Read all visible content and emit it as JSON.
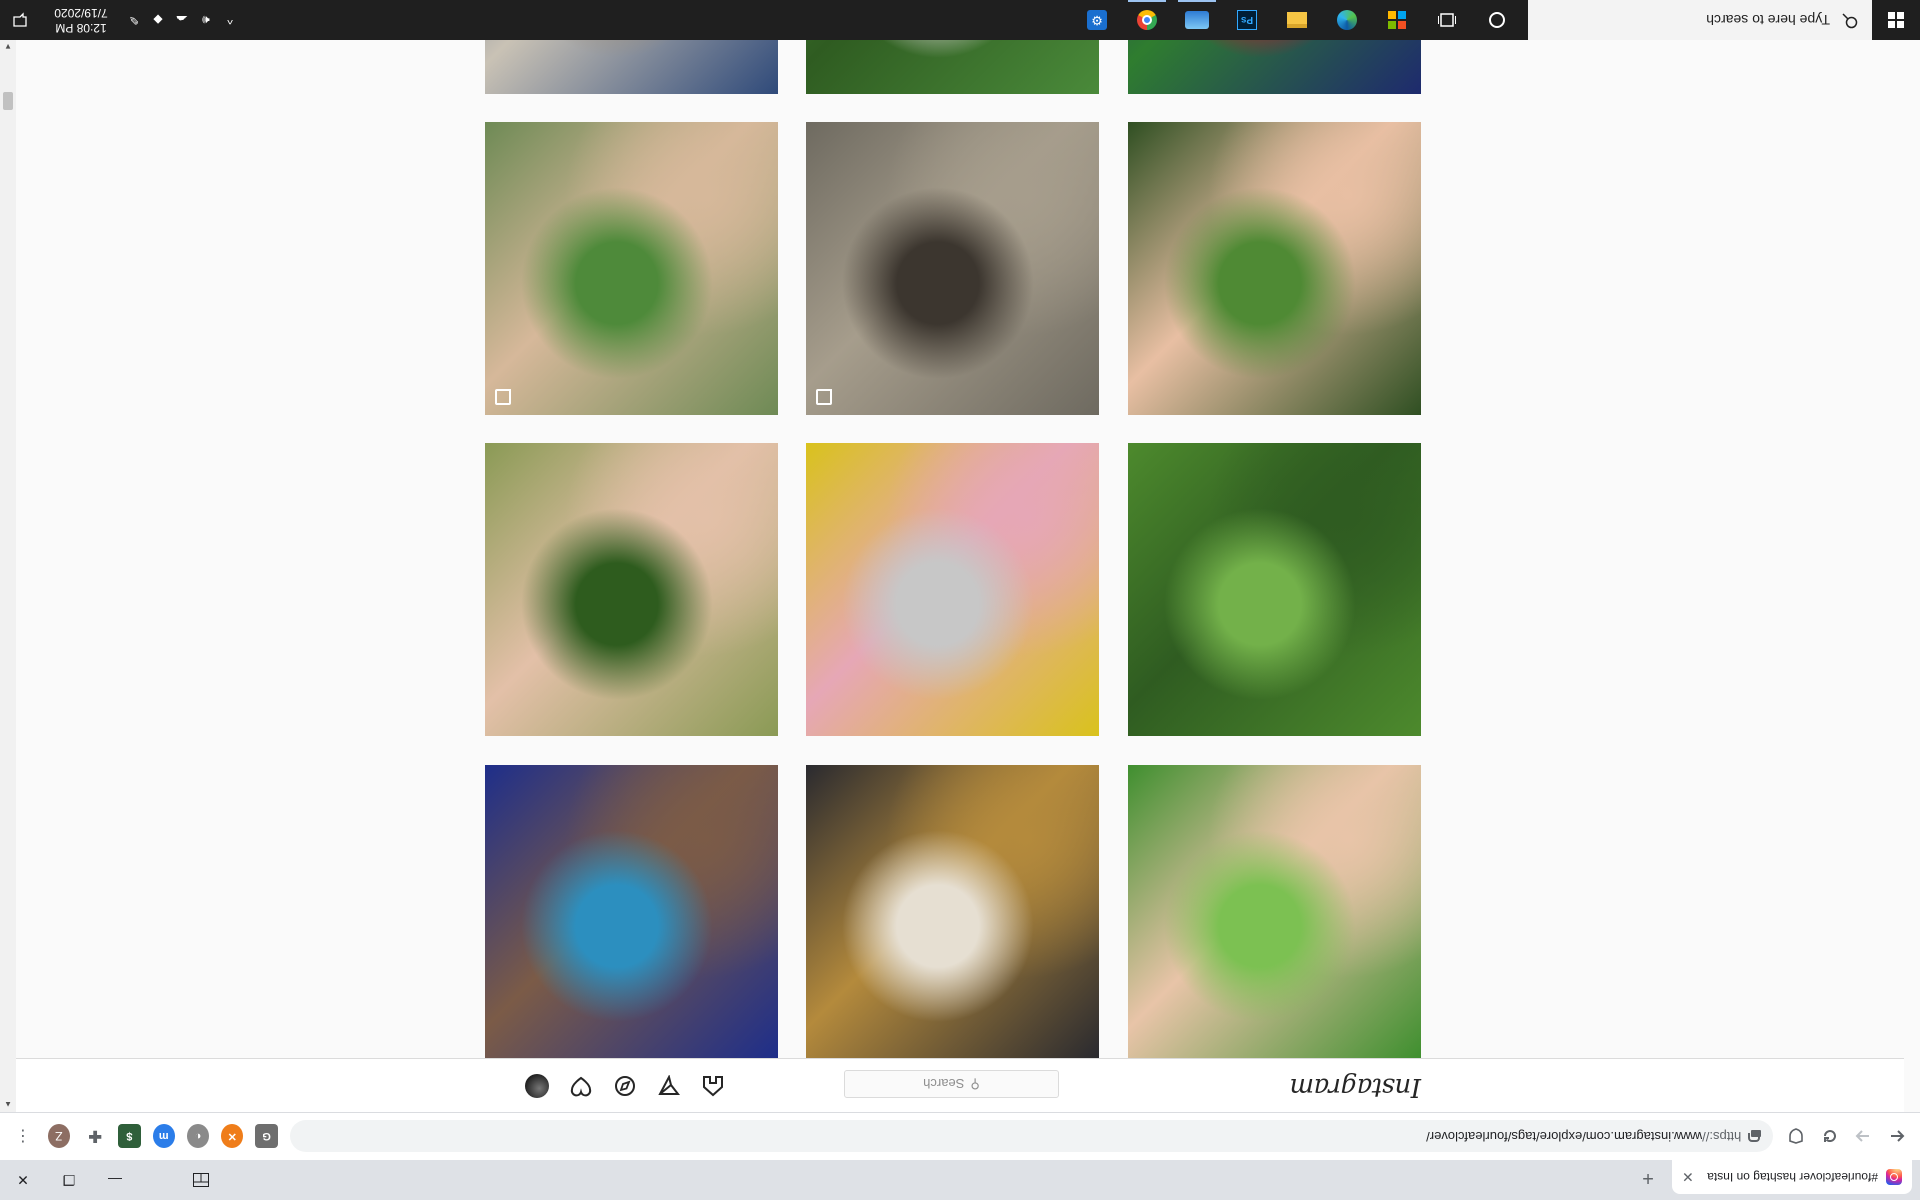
{
  "browser": {
    "tab_title": "#fourleafclover hashtag on Insta",
    "tab_close": "✕",
    "new_tab": "+",
    "url_scheme": "https://",
    "url_rest": "www.instagram.com/explore/tags/fourleafclover/",
    "profile_initial": "Z",
    "window_controls": {
      "minimize": "—",
      "restore": "❐",
      "close": "✕"
    }
  },
  "instagram": {
    "logo": "Instagram",
    "search_placeholder": "Search",
    "nav_icons": [
      "home-icon",
      "direct-icon",
      "explore-icon",
      "activity-icon",
      "profile-avatar"
    ]
  },
  "grid": {
    "tiles": [
      {
        "name": "hand-ring-clover",
        "row": 0,
        "col": 0,
        "palette": [
          "#3f8f2f",
          "#7cc152",
          "#e8c4a8"
        ]
      },
      {
        "name": "white-flowers-costume",
        "row": 0,
        "col": 1,
        "palette": [
          "#2a2a2f",
          "#e6dfd2",
          "#b48a3c"
        ]
      },
      {
        "name": "blue-clover-pouf",
        "row": 0,
        "col": 2,
        "palette": [
          "#1e2e8a",
          "#2c8fbf",
          "#7b5b47"
        ]
      },
      {
        "name": "four-leaf-clover-grass",
        "row": 1,
        "col": 0,
        "palette": [
          "#4d8a2d",
          "#73b14a",
          "#2f5c21"
        ]
      },
      {
        "name": "girl-yellow-flowers",
        "row": 1,
        "col": 1,
        "palette": [
          "#d9c21c",
          "#c7c7c7",
          "#e6a7b6"
        ]
      },
      {
        "name": "hand-picking-clover",
        "row": 1,
        "col": 2,
        "palette": [
          "#8a9a55",
          "#2e5c1e",
          "#e3c0a8"
        ]
      },
      {
        "name": "hand-holding-clover",
        "row": 2,
        "col": 0,
        "palette": [
          "#2f4f22",
          "#4f8a34",
          "#e8bfa3"
        ]
      },
      {
        "name": "cement-saw",
        "row": 2,
        "col": 1,
        "palette": [
          "#6e6a60",
          "#3c362f",
          "#a69d8c"
        ],
        "multi": true
      },
      {
        "name": "closeup-clover",
        "row": 2,
        "col": 2,
        "palette": [
          "#6e8a55",
          "#4e8a3a",
          "#d6b89a"
        ],
        "multi": true
      },
      {
        "name": "flag-clover",
        "row": 3,
        "col": 0,
        "palette": [
          "#1e2a6e",
          "#c8102e",
          "#2f7d2f"
        ]
      },
      {
        "name": "clover-flowers",
        "row": 3,
        "col": 1,
        "palette": [
          "#4a8a3a",
          "#e8dfe3",
          "#2f5c21"
        ]
      },
      {
        "name": "denim-pillows-stump",
        "row": 3,
        "col": 2,
        "palette": [
          "#2f4a7a",
          "#9a8f80",
          "#c9c2b5"
        ]
      }
    ]
  },
  "taskbar": {
    "search_placeholder": "Type here to search",
    "time": "12:08 PM",
    "date": "7/19/2020",
    "apps": [
      "cortana-icon",
      "task-view-icon",
      "store-icon",
      "edge-icon",
      "file-explorer-icon",
      "photoshop-icon",
      "onedrive-icon",
      "chrome-icon",
      "settings-icon"
    ],
    "tray": [
      "chevron-up-icon",
      "volume-icon",
      "onedrive-cloud-icon",
      "dropbox-icon",
      "pen-icon"
    ]
  }
}
